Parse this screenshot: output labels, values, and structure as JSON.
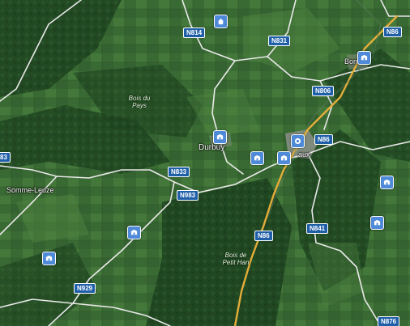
{
  "colors": {
    "terrain": "#2f5a2c",
    "road_white": "#e8e8e8",
    "road_major": "#e3ad3a",
    "label_bg": "#1f5fa8",
    "poi": "#4f8ad8"
  },
  "places": {
    "durbuy": "Durbuy",
    "somme_leuze": "Somme-Leuze",
    "bomal_partial": "Bom",
    "vaux_partial": "aux"
  },
  "forests": {
    "bois_du_pays_1": "Bois du",
    "bois_du_pays_2": "Pays",
    "bois_de_petit_han_1": "Bois de",
    "bois_de_petit_han_2": "Petit Han"
  },
  "roads": {
    "n814": "N814",
    "n831": "N831",
    "n86_top": "N86",
    "n806": "N806",
    "n86_mid": "N86",
    "n833": "N833",
    "n983": "N983",
    "n86_low": "N86",
    "n841": "N841",
    "n929": "N929",
    "n876": "N876",
    "e3_partial": "83"
  },
  "icons": {
    "home": "home-icon",
    "pin": "location-pin-icon",
    "landmark": "landmark-icon"
  }
}
